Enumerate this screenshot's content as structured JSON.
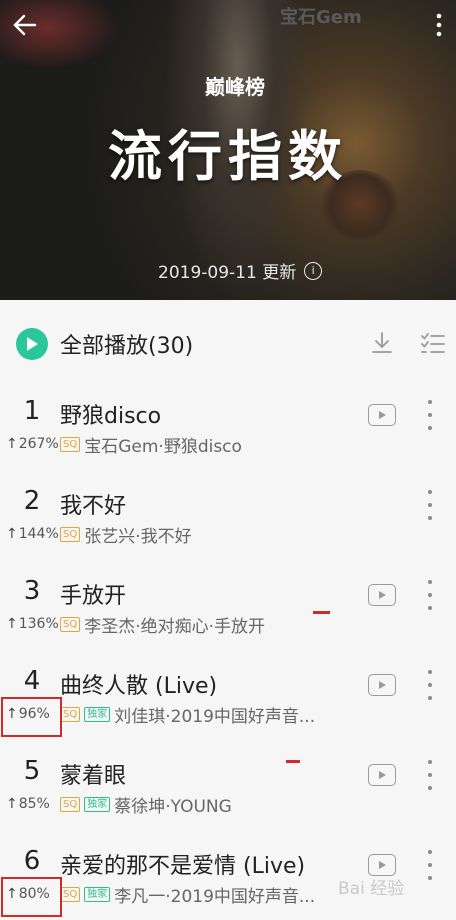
{
  "hero": {
    "title": "流行指数",
    "update_text": "2019-09-11 更新",
    "brand_text": "宝石Gem",
    "logo_text": "巅峰榜"
  },
  "controls": {
    "play_all_label": "全部播放(30)"
  },
  "songs": [
    {
      "rank": "1",
      "trend": "267%",
      "title": "野狼disco",
      "artist": "宝石Gem·野狼disco",
      "exclusive": false,
      "mv": true
    },
    {
      "rank": "2",
      "trend": "144%",
      "title": "我不好",
      "artist": "张艺兴·我不好",
      "exclusive": false,
      "mv": false
    },
    {
      "rank": "3",
      "trend": "136%",
      "title": "手放开",
      "artist": "李圣杰·绝对痴心·手放开",
      "exclusive": false,
      "mv": true
    },
    {
      "rank": "4",
      "trend": "96%",
      "title": "曲终人散 (Live)",
      "artist": "刘佳琪·2019中国好声音...",
      "exclusive": true,
      "mv": true
    },
    {
      "rank": "5",
      "trend": "85%",
      "title": "蒙着眼",
      "artist": "蔡徐坤·YOUNG",
      "exclusive": true,
      "mv": true
    },
    {
      "rank": "6",
      "trend": "80%",
      "title": "亲爱的那不是爱情 (Live)",
      "artist": "李凡一·2019中国好声音...",
      "exclusive": true,
      "mv": true
    }
  ],
  "badges": {
    "sq": "SQ",
    "exclusive": "独家"
  },
  "watermark": "Bai 经验",
  "colors": {
    "accent": "#2bc79a",
    "sq": "#e2a536",
    "exclusive": "#2bbd8c",
    "highlight": "#d02b2b"
  }
}
